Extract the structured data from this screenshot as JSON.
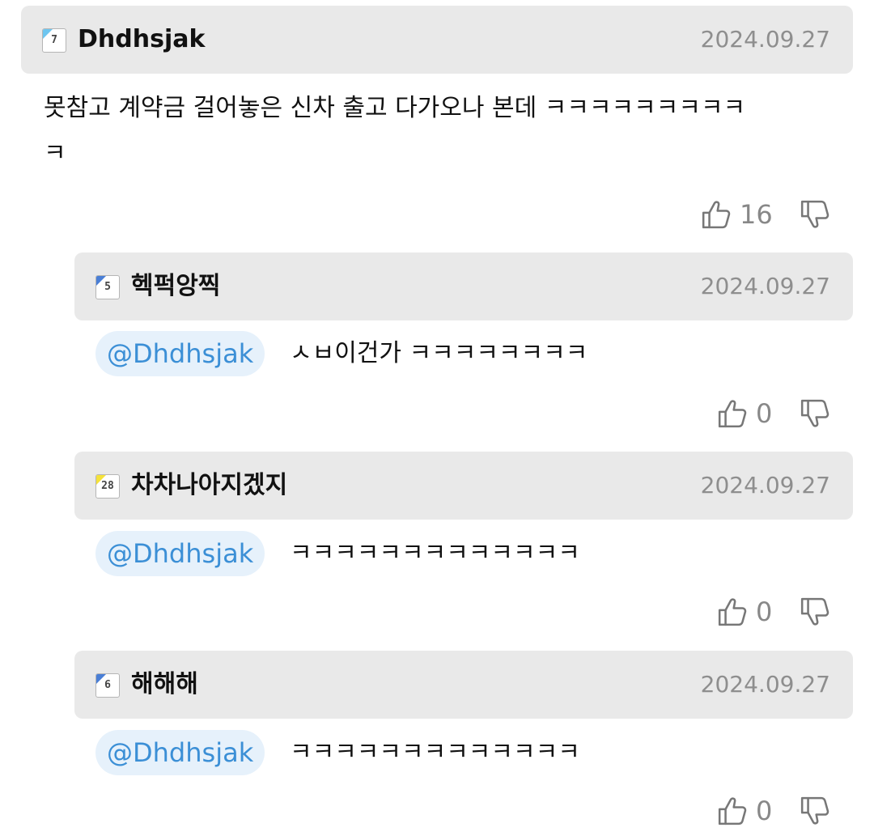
{
  "comment": {
    "author": "Dhdhsjak",
    "level": "7",
    "level_color": "#6ec6f0",
    "date": "2024.09.27",
    "text": "못참고 계약금 걸어놓은 신차 출고 다가오나 본데 ㅋㅋㅋㅋㅋㅋㅋㅋㅋ",
    "text_cont": "ㅋ",
    "likes": "16"
  },
  "replies": [
    {
      "author": "헥퍽앙찍",
      "level": "5",
      "level_color": "#4a7fd6",
      "date": "2024.09.27",
      "mention": "@Dhdhsjak",
      "text": "ㅅㅂ이건가 ㅋㅋㅋㅋㅋㅋㅋㅋ",
      "likes": "0"
    },
    {
      "author": "차차나아지겠지",
      "level": "28",
      "level_color": "#f5e23a",
      "date": "2024.09.27",
      "mention": "@Dhdhsjak",
      "text": "ㅋㅋㅋㅋㅋㅋㅋㅋㅋㅋㅋㅋㅋ",
      "likes": "0"
    },
    {
      "author": "해해해",
      "level": "6",
      "level_color": "#4a7fd6",
      "date": "2024.09.27",
      "mention": "@Dhdhsjak",
      "text": "ㅋㅋㅋㅋㅋㅋㅋㅋㅋㅋㅋㅋㅋ",
      "likes": "0"
    }
  ],
  "icons": {
    "like": "thumbs-up-icon",
    "dislike": "thumbs-down-icon"
  }
}
